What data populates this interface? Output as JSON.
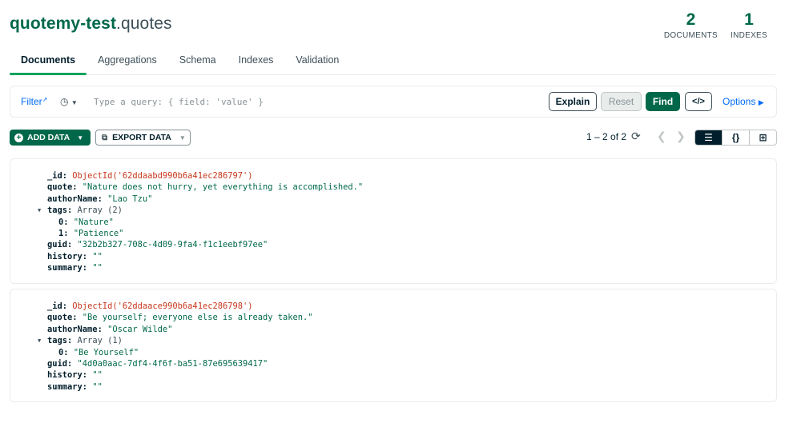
{
  "header": {
    "db_name": "quotemy-test",
    "separator": ".",
    "collection_name": "quotes",
    "documents_count": "2",
    "documents_label": "DOCUMENTS",
    "indexes_count": "1",
    "indexes_label": "INDEXES"
  },
  "tabs": [
    {
      "label": "Documents",
      "active": true
    },
    {
      "label": "Aggregations"
    },
    {
      "label": "Schema"
    },
    {
      "label": "Indexes"
    },
    {
      "label": "Validation"
    }
  ],
  "query_bar": {
    "filter_label": "Filter",
    "placeholder": "Type a query: { field: 'value' }",
    "explain_label": "Explain",
    "reset_label": "Reset",
    "find_label": "Find",
    "code_label": "</>",
    "options_label": "Options"
  },
  "toolbar": {
    "add_data_label": "ADD DATA",
    "export_data_label": "EXPORT DATA",
    "pagination": "1 – 2 of 2"
  },
  "icons": {
    "history": "clock-icon",
    "refresh": "refresh-icon",
    "list_view": "list-view-icon",
    "json_view": "json-view-icon",
    "table_view": "table-view-icon"
  },
  "colors": {
    "brand_green": "#00684a",
    "accent_green": "#00a35c",
    "link_blue": "#016bf8",
    "objectid_red": "#c7371c"
  },
  "documents": [
    {
      "id_key": "_id",
      "id_value": "ObjectId('62ddaabd990b6a41ec286797')",
      "quote_key": "quote",
      "quote_value": "\"Nature does not hurry, yet everything is accomplished.\"",
      "author_key": "authorName",
      "author_value": "\"Lao Tzu\"",
      "tags_key": "tags",
      "tags_type": "Array (2)",
      "tags": [
        {
          "index": "0",
          "value": "\"Nature\""
        },
        {
          "index": "1",
          "value": "\"Patience\""
        }
      ],
      "guid_key": "guid",
      "guid_value": "\"32b2b327-708c-4d09-9fa4-f1c1eebf97ee\"",
      "history_key": "history",
      "history_value": "\"\"",
      "summary_key": "summary",
      "summary_value": "\"\""
    },
    {
      "id_key": "_id",
      "id_value": "ObjectId('62ddaace990b6a41ec286798')",
      "quote_key": "quote",
      "quote_value": "\"Be yourself; everyone else is already taken.\"",
      "author_key": "authorName",
      "author_value": "\"Oscar Wilde\"",
      "tags_key": "tags",
      "tags_type": "Array (1)",
      "tags": [
        {
          "index": "0",
          "value": "\"Be Yourself\""
        }
      ],
      "guid_key": "guid",
      "guid_value": "\"4d0a0aac-7df4-4f6f-ba51-87e695639417\"",
      "history_key": "history",
      "history_value": "\"\"",
      "summary_key": "summary",
      "summary_value": "\"\""
    }
  ]
}
